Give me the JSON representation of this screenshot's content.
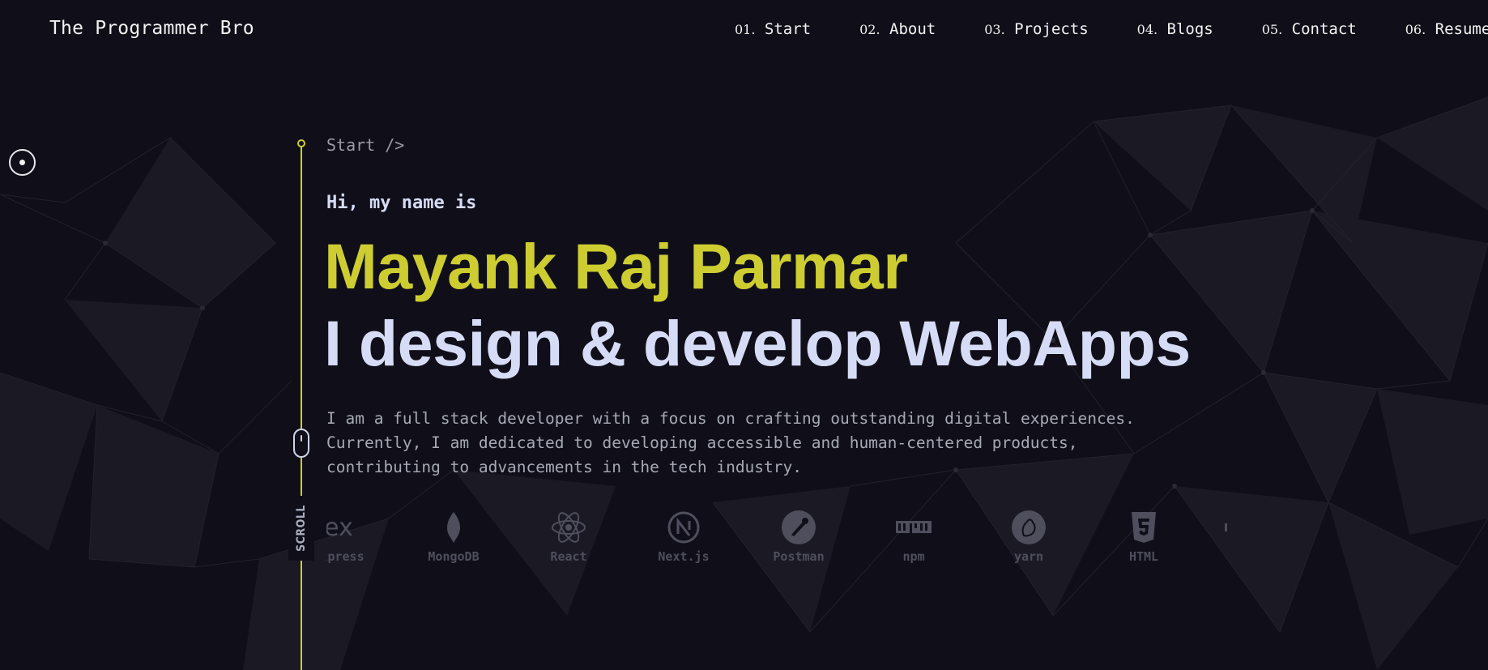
{
  "header": {
    "brand": "The Programmer Bro",
    "nav": [
      {
        "num": "01.",
        "label": "Start"
      },
      {
        "num": "02.",
        "label": "About"
      },
      {
        "num": "03.",
        "label": "Projects"
      },
      {
        "num": "04.",
        "label": "Blogs"
      },
      {
        "num": "05.",
        "label": "Contact"
      },
      {
        "num": "06.",
        "label": "Resume"
      }
    ]
  },
  "hero": {
    "section_tag": "Start />",
    "greeting": "Hi, my name is",
    "name": "Mayank Raj Parmar",
    "tagline": "I design & develop WebApps",
    "bio": [
      "I am a full stack developer with a focus on crafting outstanding digital experiences.",
      "Currently, I am dedicated to developing accessible and human-centered products,",
      "contributing to advancements in the tech industry."
    ],
    "scroll_label": "SCROLL"
  },
  "tech_stack": [
    {
      "label": "Express",
      "icon": "express-icon"
    },
    {
      "label": "MongoDB",
      "icon": "mongodb-icon"
    },
    {
      "label": "React",
      "icon": "react-icon"
    },
    {
      "label": "Next.js",
      "icon": "nextjs-icon"
    },
    {
      "label": "Postman",
      "icon": "postman-icon"
    },
    {
      "label": "npm",
      "icon": "npm-icon"
    },
    {
      "label": "yarn",
      "icon": "yarn-icon"
    },
    {
      "label": "HTML",
      "icon": "html5-icon"
    }
  ],
  "colors": {
    "background": "#100f19",
    "accent": "#cdcd31",
    "heading": "#d6dcf5",
    "body_text": "#a6a9b4",
    "muted_icon": "#4e4e5c"
  }
}
